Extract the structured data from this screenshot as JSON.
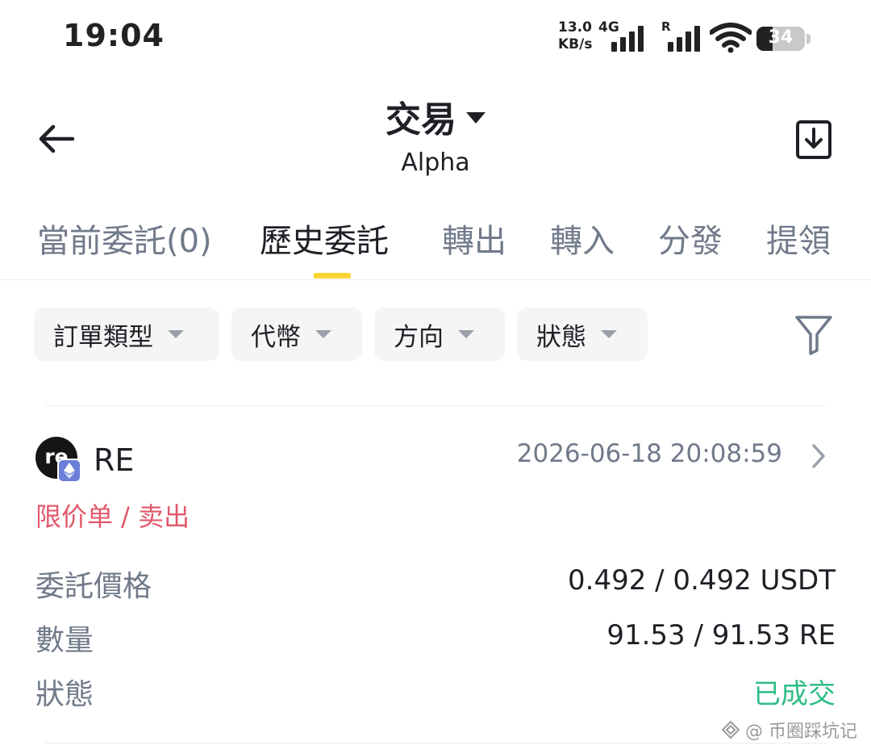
{
  "status_bar": {
    "time": "19:04",
    "net_speed_value": "13.0",
    "net_speed_unit": "KB/s",
    "network_type": "4G",
    "roaming_label": "R",
    "battery_level": "34"
  },
  "header": {
    "title": "交易",
    "subtitle": "Alpha",
    "back_icon": "arrow-left-icon",
    "download_icon": "download-icon"
  },
  "tabs": [
    {
      "label": "當前委託(0)",
      "active": false
    },
    {
      "label": "歷史委託",
      "active": true
    },
    {
      "label": "轉出",
      "active": false
    },
    {
      "label": "轉入",
      "active": false
    },
    {
      "label": "分發",
      "active": false
    },
    {
      "label": "提領",
      "active": false
    }
  ],
  "filters": [
    {
      "label": "訂單類型"
    },
    {
      "label": "代幣"
    },
    {
      "label": "方向"
    },
    {
      "label": "狀態"
    }
  ],
  "order": {
    "token_logo_text": "re",
    "token": "RE",
    "time": "2026-06-18 20:08:59",
    "type": "限价单 / 卖出",
    "fields": [
      {
        "label": "委託價格",
        "value": "0.492 / 0.492 USDT"
      },
      {
        "label": "數量",
        "value": "91.53 / 91.53 RE"
      },
      {
        "label": "狀態",
        "value": "已成交"
      }
    ]
  },
  "colors": {
    "accent": "#fcd535",
    "sell": "#e1596b",
    "filled": "#2ebd85",
    "muted": "#707a8a"
  },
  "watermark": "@ 币圈踩坑记"
}
